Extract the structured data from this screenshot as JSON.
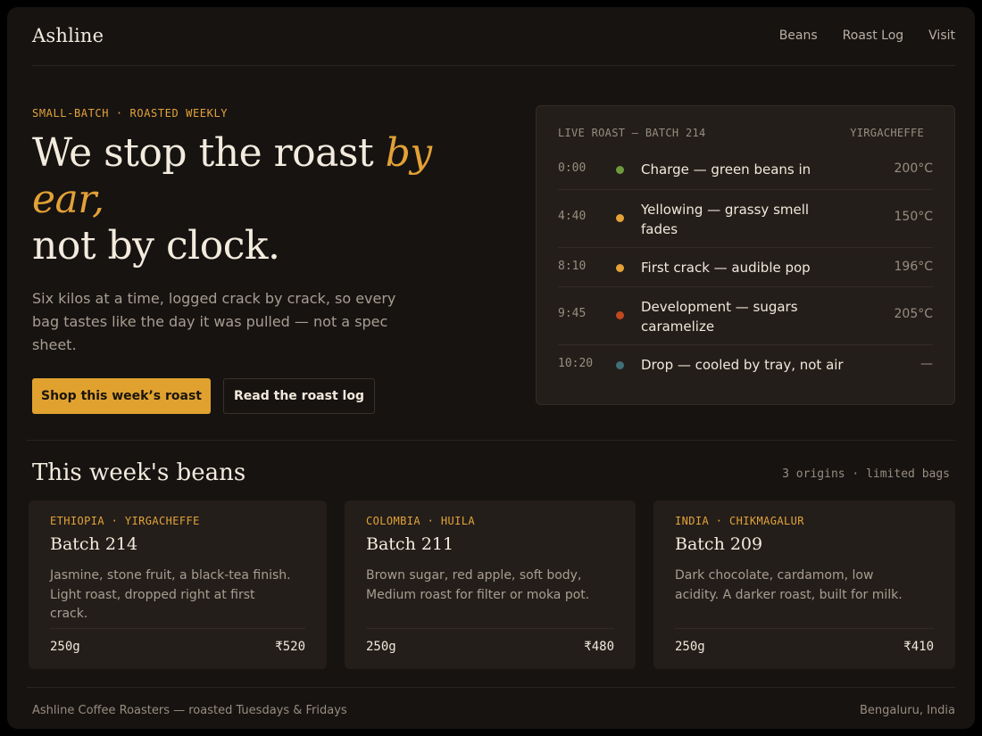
{
  "brand": "Ashline",
  "nav": [
    "Beans",
    "Roast Log",
    "Visit"
  ],
  "hero": {
    "eyebrow": "SMALL-BATCH · ROASTED WEEKLY",
    "headline_before": "We stop the roast ",
    "headline_accent": "by ear,",
    "headline_after": "not by clock.",
    "lede": "Six kilos at a time, logged crack by crack, so every bag tastes like the day it was pulled — not a spec sheet.",
    "primary_button": "Shop this week’s roast",
    "secondary_button": "Read the roast log"
  },
  "roast_panel": {
    "title": "LIVE ROAST — BATCH 214",
    "origin": "YIRGACHEFFE",
    "rows": [
      {
        "time": "0:00",
        "event": "Charge — green beans in",
        "temp": "200°C",
        "dot_color": "#6e9a3c"
      },
      {
        "time": "4:40",
        "event": "Yellowing — grassy smell fades",
        "temp": "150°C",
        "dot_color": "#e3a136"
      },
      {
        "time": "8:10",
        "event": "First crack — audible pop",
        "temp": "196°C",
        "dot_color": "#e3a136"
      },
      {
        "time": "9:45",
        "event": "Development — sugars caramelize",
        "temp": "205°C",
        "dot_color": "#c0481f"
      },
      {
        "time": "10:20",
        "event": "Drop — cooled by tray, not air",
        "temp": "—",
        "dot_color": "#3f6f77"
      }
    ]
  },
  "beans": {
    "title": "This week's beans",
    "meta": "3 origins · limited bags",
    "cards": [
      {
        "origin": "ETHIOPIA · YIRGACHEFFE",
        "batch": "Batch 214",
        "notes": "Jasmine, stone fruit, a black-tea finish. Light roast, dropped right at first crack.",
        "weight": "250g",
        "price": "₹520"
      },
      {
        "origin": "COLOMBIA · HUILA",
        "batch": "Batch 211",
        "notes": "Brown sugar, red apple, soft body, Medium roast for filter or moka pot.",
        "weight": "250g",
        "price": "₹480"
      },
      {
        "origin": "INDIA · CHIKMAGALUR",
        "batch": "Batch 209",
        "notes": "Dark chocolate, cardamom, low acidity. A darker roast, built for milk.",
        "weight": "250g",
        "price": "₹410"
      }
    ]
  },
  "footer": {
    "left": "Ashline Coffee Roasters — roasted Tuesdays & Fridays",
    "right": "Bengaluru, India"
  }
}
